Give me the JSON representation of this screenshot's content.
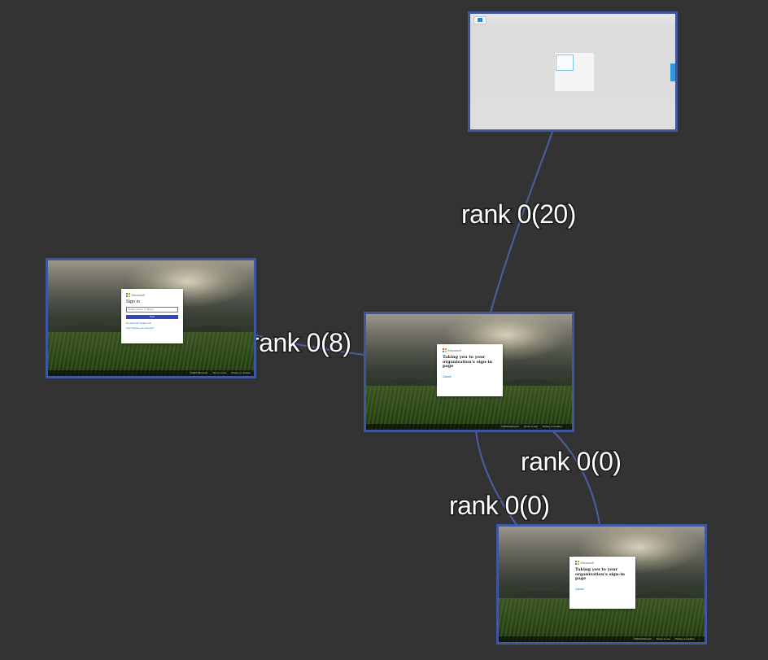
{
  "diagram": {
    "background": "#333333",
    "node_border_color": "#3f57a0",
    "edge_color": "#4a5fa8",
    "nodes": [
      {
        "id": "node-top",
        "kind": "blank-gray-page"
      },
      {
        "id": "node-left",
        "kind": "sign-in",
        "brand": "Microsoft",
        "heading": "Sign in",
        "input_placeholder": "Email, phone, or Skype",
        "button": "Next",
        "line1": "No account? Create one!",
        "line2": "Can't access your account?",
        "footer": [
          "©2023 Microsoft",
          "Terms of use",
          "Privacy & cookies"
        ]
      },
      {
        "id": "node-center",
        "kind": "redirect",
        "brand": "Microsoft",
        "heading": "Taking you to your organization's sign-in page",
        "dots": "...",
        "link": "Cancel",
        "footer": [
          "©2023 Microsoft",
          "Terms of use",
          "Privacy & cookies",
          "..."
        ]
      },
      {
        "id": "node-bottom",
        "kind": "redirect",
        "brand": "Microsoft",
        "heading": "Taking you to your organization's sign-in page",
        "dots": "...",
        "link": "Cancel",
        "footer": [
          "©2023 Microsoft",
          "Terms of use",
          "Privacy & cookies",
          "..."
        ]
      }
    ],
    "edges": [
      {
        "from": "node-top",
        "to": "node-center",
        "label": "rank 0(20)"
      },
      {
        "from": "node-center",
        "to": "node-left",
        "label": "rank 0(8)"
      },
      {
        "from": "node-center",
        "to": "node-bottom",
        "label": "rank 0(0)"
      },
      {
        "from": "node-center",
        "to": "node-bottom",
        "label": "rank 0(0)"
      }
    ]
  }
}
